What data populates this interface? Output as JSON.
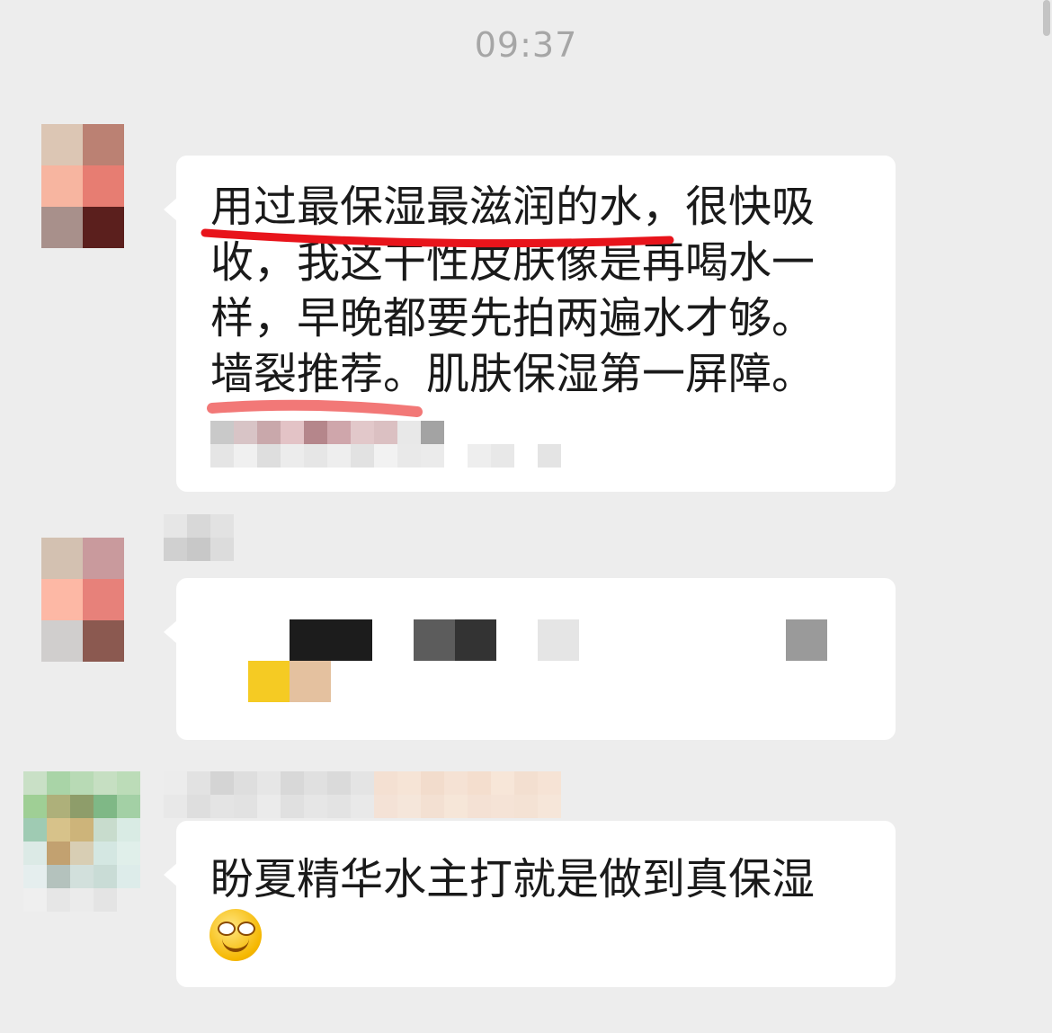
{
  "header": {
    "timestamp": "09:37"
  },
  "messages": [
    {
      "sender_name_blurred": true,
      "text_lines": [
        "用过最保湿最滋润的水，很快吸",
        "收，我这干性皮肤像是再喝水一",
        "样，早晚都要先拍两遍水才够。",
        "墙裂推荐。肌肤保湿第一屏障。"
      ],
      "highlight_color": "#e8141b"
    },
    {
      "sender_name_blurred": true,
      "content_blurred": true
    },
    {
      "sender_name_blurred": true,
      "text": "盼夏精华水主打就是做到真保湿",
      "emoji": "smiling-face-icon"
    }
  ]
}
